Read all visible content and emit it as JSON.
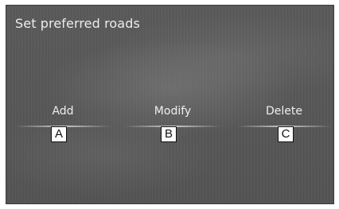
{
  "screen": {
    "title": "Set preferred roads"
  },
  "options": [
    {
      "label": "Add"
    },
    {
      "label": "Modify"
    },
    {
      "label": "Delete"
    }
  ],
  "callouts": [
    "A",
    "B",
    "C"
  ],
  "colors": {
    "background": "#585858",
    "text": "#efefef",
    "callout_border": "#111111"
  }
}
